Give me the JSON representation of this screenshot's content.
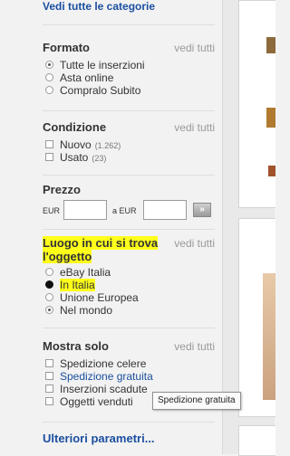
{
  "top_link": "Vedi tutte le categorie",
  "formato": {
    "title": "Formato",
    "vedi_tutti": "vedi tutti",
    "options": [
      "Tutte le inserzioni",
      "Asta online",
      "Compralo Subito"
    ]
  },
  "condizione": {
    "title": "Condizione",
    "vedi_tutti": "vedi tutti",
    "options": [
      {
        "label": "Nuovo",
        "count": "(1.262)"
      },
      {
        "label": "Usato",
        "count": "(23)"
      }
    ]
  },
  "prezzo": {
    "title": "Prezzo",
    "currency_min": "EUR",
    "separator": "a EUR",
    "go_label": "»"
  },
  "luogo": {
    "title_line1": "Luogo in cui si trova",
    "title_line2": "l'oggetto",
    "vedi_tutti": "vedi tutti",
    "options": [
      "eBay Italia",
      "In Italia",
      "Unione Europea",
      "Nel mondo"
    ]
  },
  "mostra_solo": {
    "title": "Mostra solo",
    "vedi_tutti": "vedi tutti",
    "options": [
      "Spedizione celere",
      "Spedizione gratuita",
      "Inserzioni scadute",
      "Oggetti venduti"
    ]
  },
  "tooltip": "Spedizione gratuita",
  "more_link": "Ulteriori parametri..."
}
